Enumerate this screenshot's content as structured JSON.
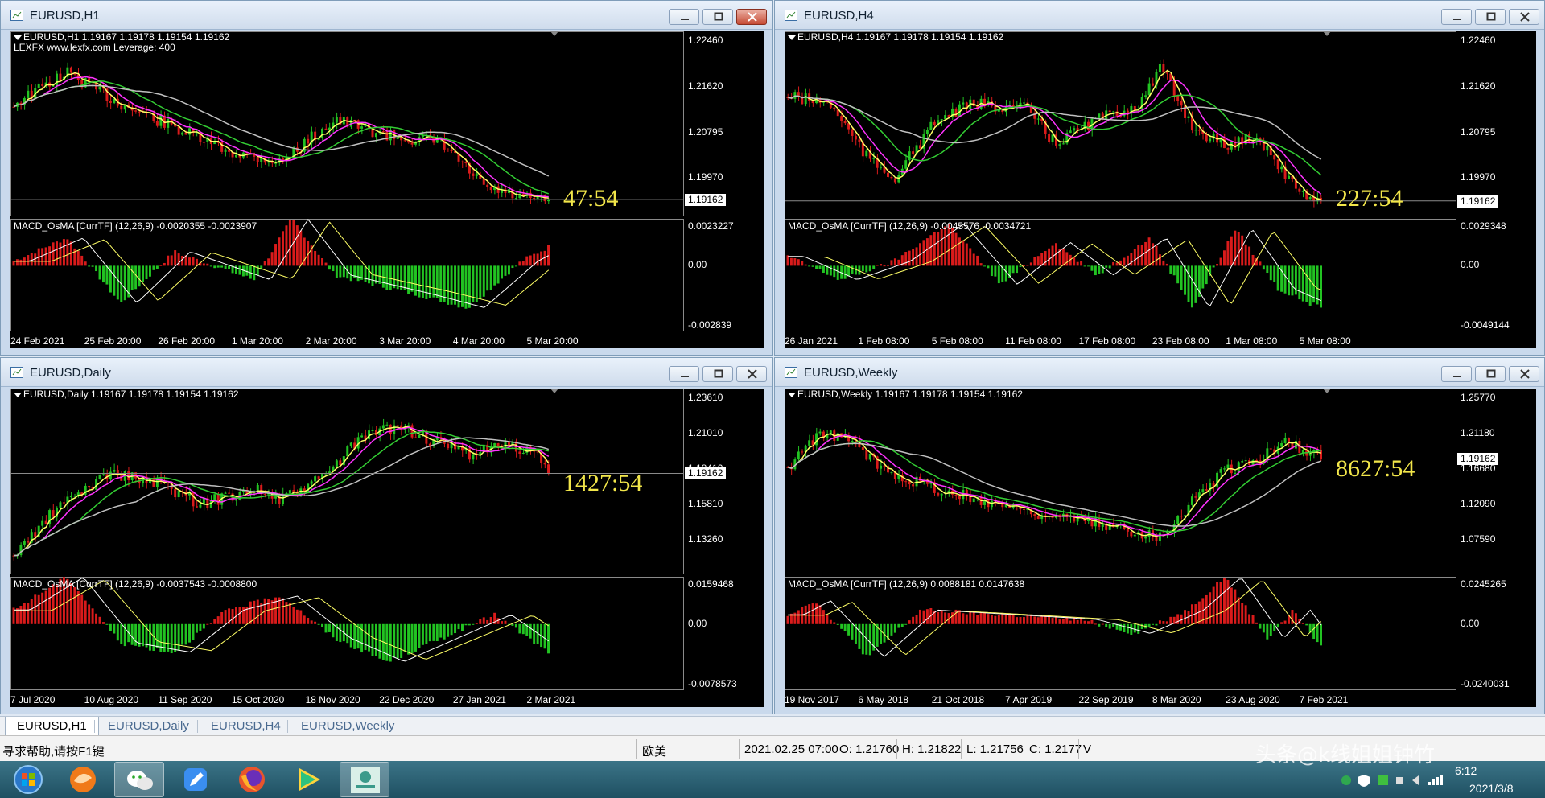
{
  "colors": {
    "bull_candle": "#22c322",
    "bear_candle": "#d91b1b",
    "ma_fast": "#ffff66",
    "ma_slow1": "#ff33ff",
    "ma_slow2": "#33cc33",
    "ma_slow3": "#c0c0c0",
    "countdown": "#f2e64a",
    "chart_bg": "#000000"
  },
  "windows": [
    {
      "id": "h1",
      "title": "EURUSD,H1",
      "header_line": "EURUSD,H1  1.19167 1.19178 1.19154 1.19162",
      "broker_line": "LEXFX www.lexfx.com Leverage: 400",
      "price_box": "1.19162",
      "countdown": "47:54",
      "price_axis": [
        "1.22460",
        "1.21620",
        "1.20795",
        "1.19970"
      ],
      "macd_label": "MACD_OsMA [CurrTF] (12,26,9) -0.0020355 -0.0023907",
      "macd_axis": [
        "0.0023227",
        "0.00",
        "-0.002839"
      ],
      "time_axis": [
        "24 Feb 2021",
        "25 Feb 20:00",
        "26 Feb 20:00",
        "1 Mar 20:00",
        "2 Mar 20:00",
        "3 Mar 20:00",
        "4 Mar 20:00",
        "5 Mar 20:00"
      ]
    },
    {
      "id": "h4",
      "title": "EURUSD,H4",
      "header_line": "EURUSD,H4  1.19167 1.19178 1.19154 1.19162",
      "broker_line": "",
      "price_box": "1.19162",
      "countdown": "227:54",
      "price_axis": [
        "1.22460",
        "1.21620",
        "1.20795",
        "1.19970"
      ],
      "macd_label": "MACD_OsMA [CurrTF] (12,26,9) -0.0045576 -0.0034721",
      "macd_axis": [
        "0.0029348",
        "0.00",
        "-0.0049144"
      ],
      "time_axis": [
        "26 Jan 2021",
        "1 Feb 08:00",
        "5 Feb 08:00",
        "11 Feb 08:00",
        "17 Feb 08:00",
        "23 Feb 08:00",
        "1 Mar 08:00",
        "5 Mar 08:00"
      ]
    },
    {
      "id": "d1",
      "title": "EURUSD,Daily",
      "header_line": "EURUSD,Daily  1.19167 1.19178 1.19154 1.19162",
      "broker_line": "",
      "price_box": "1.19162",
      "countdown": "1427:54",
      "price_axis": [
        "1.23610",
        "1.21010",
        "1.18410",
        "1.15810",
        "1.13260"
      ],
      "macd_label": "MACD_OsMA [CurrTF] (12,26,9) -0.0037543 -0.0008800",
      "macd_axis": [
        "0.0159468",
        "0.00",
        "-0.0078573"
      ],
      "time_axis": [
        "7 Jul 2020",
        "10 Aug 2020",
        "11 Sep 2020",
        "15 Oct 2020",
        "18 Nov 2020",
        "22 Dec 2020",
        "27 Jan 2021",
        "2 Mar 2021"
      ]
    },
    {
      "id": "w1",
      "title": "EURUSD,Weekly",
      "header_line": "EURUSD,Weekly  1.19167 1.19178 1.19154 1.19162",
      "broker_line": "",
      "price_box": "1.19162",
      "countdown": "8627:54",
      "price_axis": [
        "1.25770",
        "1.21180",
        "1.16680",
        "1.12090",
        "1.07590"
      ],
      "macd_label": "MACD_OsMA [CurrTF] (12,26,9) 0.0088181 0.0147638",
      "macd_axis": [
        "0.0245265",
        "0.00",
        "-0.0240031"
      ],
      "time_axis": [
        "19 Nov 2017",
        "6 May 2018",
        "21 Oct 2018",
        "7 Apr 2019",
        "22 Sep 2019",
        "8 Mar 2020",
        "23 Aug 2020",
        "7 Feb 2021"
      ]
    }
  ],
  "tabs": [
    "EURUSD,H1",
    "EURUSD,Daily",
    "EURUSD,H4",
    "EURUSD,Weekly"
  ],
  "active_tab": "EURUSD,H1",
  "status": {
    "help": "寻求帮助,请按F1键",
    "profile": "欧美",
    "datetime": "2021.02.25 07:00",
    "open": "O: 1.21760",
    "high": "H: 1.21822",
    "low": "L: 1.21756",
    "close": "C: 1.2177",
    "volume": "V"
  },
  "taskbar": {
    "apps": [
      "start-orb-icon",
      "browser-swirl-icon",
      "wechat-icon",
      "pen-app-icon",
      "firefox-icon",
      "media-player-icon",
      "mt4-terminal-icon"
    ],
    "time": "6:12",
    "date": "2021/3/8"
  },
  "watermark": "头条@k线姐姐钟竹"
}
